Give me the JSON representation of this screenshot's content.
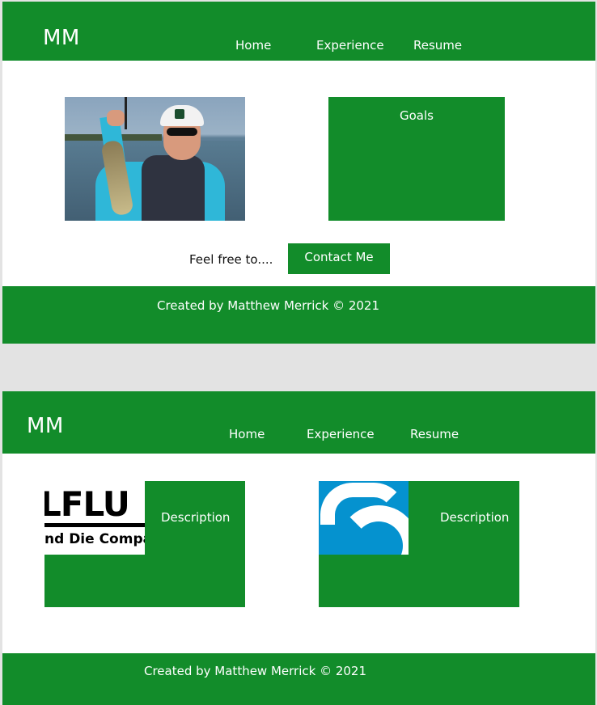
{
  "page1": {
    "header": {
      "logo": "MM",
      "nav": [
        "Home",
        "Experience",
        "Resume"
      ]
    },
    "goals": {
      "title": "Goals"
    },
    "contact": {
      "prompt": "Feel free to....",
      "button_label": "Contact Me"
    },
    "footer": {
      "text": "Created by Matthew Merrick © 2021"
    }
  },
  "page2": {
    "header": {
      "logo": "MM",
      "nav": [
        "Home",
        "Experience",
        "Resume"
      ]
    },
    "cards": [
      {
        "image_text_1": "LFLU",
        "image_text_2": "nd Die Compa",
        "description": "Description"
      },
      {
        "description": "Description"
      }
    ],
    "footer": {
      "text": "Created by Matthew Merrick ©  2021"
    }
  },
  "colors": {
    "brand_green": "#128c2a",
    "page_bg": "#e3e3e3",
    "card_image_blue": "#0592cf"
  },
  "icons": {
    "photo": "person-holding-fish-photo",
    "company_logo": "company-logo-image",
    "s_logo": "s-logo-image"
  }
}
